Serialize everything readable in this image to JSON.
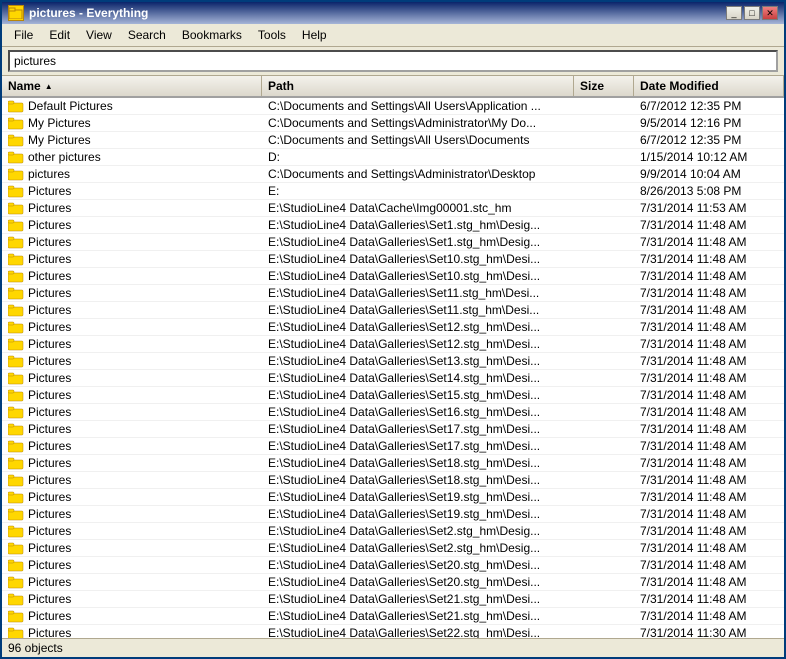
{
  "window": {
    "title": "pictures - Everything",
    "icon": "folder"
  },
  "titleButtons": {
    "minimize": "_",
    "maximize": "□",
    "close": "✕"
  },
  "menuBar": {
    "items": [
      "File",
      "Edit",
      "View",
      "Search",
      "Bookmarks",
      "Tools",
      "Help"
    ]
  },
  "searchBar": {
    "value": "pictures",
    "placeholder": ""
  },
  "columns": [
    {
      "label": "Name",
      "key": "name"
    },
    {
      "label": "Path",
      "key": "path"
    },
    {
      "label": "Size",
      "key": "size"
    },
    {
      "label": "Date Modified",
      "key": "date"
    }
  ],
  "rows": [
    {
      "name": "Default Pictures",
      "path": "C:\\Documents and Settings\\All Users\\Application ...",
      "size": "",
      "date": "6/7/2012 12:35 PM"
    },
    {
      "name": "My Pictures",
      "path": "C:\\Documents and Settings\\Administrator\\My Do...",
      "size": "",
      "date": "9/5/2014 12:16 PM"
    },
    {
      "name": "My Pictures",
      "path": "C:\\Documents and Settings\\All Users\\Documents",
      "size": "",
      "date": "6/7/2012 12:35 PM"
    },
    {
      "name": "other pictures",
      "path": "D:",
      "size": "",
      "date": "1/15/2014 10:12 AM"
    },
    {
      "name": "pictures",
      "path": "C:\\Documents and Settings\\Administrator\\Desktop",
      "size": "",
      "date": "9/9/2014 10:04 AM"
    },
    {
      "name": "Pictures",
      "path": "E:",
      "size": "",
      "date": "8/26/2013 5:08 PM"
    },
    {
      "name": "Pictures",
      "path": "E:\\StudioLine4 Data\\Cache\\Img00001.stc_hm",
      "size": "",
      "date": "7/31/2014 11:53 AM"
    },
    {
      "name": "Pictures",
      "path": "E:\\StudioLine4 Data\\Galleries\\Set1.stg_hm\\Desig...",
      "size": "",
      "date": "7/31/2014 11:48 AM"
    },
    {
      "name": "Pictures",
      "path": "E:\\StudioLine4 Data\\Galleries\\Set1.stg_hm\\Desig...",
      "size": "",
      "date": "7/31/2014 11:48 AM"
    },
    {
      "name": "Pictures",
      "path": "E:\\StudioLine4 Data\\Galleries\\Set10.stg_hm\\Desi...",
      "size": "",
      "date": "7/31/2014 11:48 AM"
    },
    {
      "name": "Pictures",
      "path": "E:\\StudioLine4 Data\\Galleries\\Set10.stg_hm\\Desi...",
      "size": "",
      "date": "7/31/2014 11:48 AM"
    },
    {
      "name": "Pictures",
      "path": "E:\\StudioLine4 Data\\Galleries\\Set11.stg_hm\\Desi...",
      "size": "",
      "date": "7/31/2014 11:48 AM"
    },
    {
      "name": "Pictures",
      "path": "E:\\StudioLine4 Data\\Galleries\\Set11.stg_hm\\Desi...",
      "size": "",
      "date": "7/31/2014 11:48 AM"
    },
    {
      "name": "Pictures",
      "path": "E:\\StudioLine4 Data\\Galleries\\Set12.stg_hm\\Desi...",
      "size": "",
      "date": "7/31/2014 11:48 AM"
    },
    {
      "name": "Pictures",
      "path": "E:\\StudioLine4 Data\\Galleries\\Set12.stg_hm\\Desi...",
      "size": "",
      "date": "7/31/2014 11:48 AM"
    },
    {
      "name": "Pictures",
      "path": "E:\\StudioLine4 Data\\Galleries\\Set13.stg_hm\\Desi...",
      "size": "",
      "date": "7/31/2014 11:48 AM"
    },
    {
      "name": "Pictures",
      "path": "E:\\StudioLine4 Data\\Galleries\\Set14.stg_hm\\Desi...",
      "size": "",
      "date": "7/31/2014 11:48 AM"
    },
    {
      "name": "Pictures",
      "path": "E:\\StudioLine4 Data\\Galleries\\Set15.stg_hm\\Desi...",
      "size": "",
      "date": "7/31/2014 11:48 AM"
    },
    {
      "name": "Pictures",
      "path": "E:\\StudioLine4 Data\\Galleries\\Set16.stg_hm\\Desi...",
      "size": "",
      "date": "7/31/2014 11:48 AM"
    },
    {
      "name": "Pictures",
      "path": "E:\\StudioLine4 Data\\Galleries\\Set17.stg_hm\\Desi...",
      "size": "",
      "date": "7/31/2014 11:48 AM"
    },
    {
      "name": "Pictures",
      "path": "E:\\StudioLine4 Data\\Galleries\\Set17.stg_hm\\Desi...",
      "size": "",
      "date": "7/31/2014 11:48 AM"
    },
    {
      "name": "Pictures",
      "path": "E:\\StudioLine4 Data\\Galleries\\Set18.stg_hm\\Desi...",
      "size": "",
      "date": "7/31/2014 11:48 AM"
    },
    {
      "name": "Pictures",
      "path": "E:\\StudioLine4 Data\\Galleries\\Set18.stg_hm\\Desi...",
      "size": "",
      "date": "7/31/2014 11:48 AM"
    },
    {
      "name": "Pictures",
      "path": "E:\\StudioLine4 Data\\Galleries\\Set19.stg_hm\\Desi...",
      "size": "",
      "date": "7/31/2014 11:48 AM"
    },
    {
      "name": "Pictures",
      "path": "E:\\StudioLine4 Data\\Galleries\\Set19.stg_hm\\Desi...",
      "size": "",
      "date": "7/31/2014 11:48 AM"
    },
    {
      "name": "Pictures",
      "path": "E:\\StudioLine4 Data\\Galleries\\Set2.stg_hm\\Desig...",
      "size": "",
      "date": "7/31/2014 11:48 AM"
    },
    {
      "name": "Pictures",
      "path": "E:\\StudioLine4 Data\\Galleries\\Set2.stg_hm\\Desig...",
      "size": "",
      "date": "7/31/2014 11:48 AM"
    },
    {
      "name": "Pictures",
      "path": "E:\\StudioLine4 Data\\Galleries\\Set20.stg_hm\\Desi...",
      "size": "",
      "date": "7/31/2014 11:48 AM"
    },
    {
      "name": "Pictures",
      "path": "E:\\StudioLine4 Data\\Galleries\\Set20.stg_hm\\Desi...",
      "size": "",
      "date": "7/31/2014 11:48 AM"
    },
    {
      "name": "Pictures",
      "path": "E:\\StudioLine4 Data\\Galleries\\Set21.stg_hm\\Desi...",
      "size": "",
      "date": "7/31/2014 11:48 AM"
    },
    {
      "name": "Pictures",
      "path": "E:\\StudioLine4 Data\\Galleries\\Set21.stg_hm\\Desi...",
      "size": "",
      "date": "7/31/2014 11:48 AM"
    },
    {
      "name": "Pictures",
      "path": "E:\\StudioLine4 Data\\Galleries\\Set22.stg_hm\\Desi...",
      "size": "",
      "date": "7/31/2014 11:30 AM"
    }
  ],
  "statusBar": {
    "text": "96 objects"
  }
}
